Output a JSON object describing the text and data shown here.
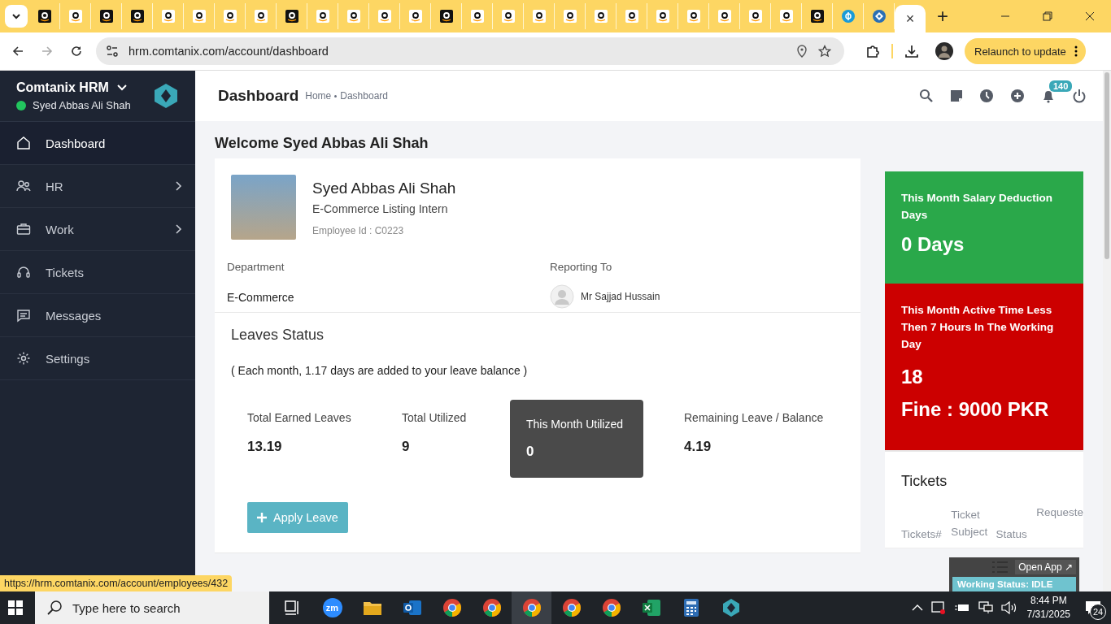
{
  "browser": {
    "tabs": [
      {
        "kind": "amazon_dark",
        "selected": false
      },
      {
        "kind": "amazon_light",
        "selected": false
      },
      {
        "kind": "amazon_dark",
        "selected": false
      },
      {
        "kind": "amazon_dark",
        "selected": false
      },
      {
        "kind": "amazon_light",
        "selected": false
      },
      {
        "kind": "amazon_light",
        "selected": false
      },
      {
        "kind": "amazon_light",
        "selected": false
      },
      {
        "kind": "amazon_light",
        "selected": false
      },
      {
        "kind": "amazon_dark",
        "selected": false
      },
      {
        "kind": "amazon_light",
        "selected": false
      },
      {
        "kind": "amazon_light",
        "selected": false
      },
      {
        "kind": "amazon_light",
        "selected": false
      },
      {
        "kind": "amazon_light",
        "selected": false
      },
      {
        "kind": "amazon_dark",
        "selected": false
      },
      {
        "kind": "amazon_light",
        "selected": false
      },
      {
        "kind": "amazon_light",
        "selected": false
      },
      {
        "kind": "amazon_light",
        "selected": false
      },
      {
        "kind": "amazon_light",
        "selected": false
      },
      {
        "kind": "amazon_light",
        "selected": false
      },
      {
        "kind": "amazon_light",
        "selected": false
      },
      {
        "kind": "amazon_light",
        "selected": false
      },
      {
        "kind": "amazon_light",
        "selected": false
      },
      {
        "kind": "amazon_light",
        "selected": false
      },
      {
        "kind": "amazon_light",
        "selected": false
      },
      {
        "kind": "amazon_light",
        "selected": false
      },
      {
        "kind": "amazon_dark",
        "selected": false
      },
      {
        "kind": "payment",
        "selected": false
      },
      {
        "kind": "hrm",
        "selected": false
      },
      {
        "kind": "blank",
        "selected": true,
        "close": "×"
      }
    ],
    "new_tab": "+",
    "address": "hrm.comtanix.com/account/dashboard",
    "relaunch": "Relaunch to update"
  },
  "sidebar": {
    "brand": "Comtanix HRM",
    "user": "Syed Abbas Ali Shah",
    "online": true,
    "items": [
      {
        "label": "Dashboard",
        "kind": "home",
        "selected": true,
        "has_children": false
      },
      {
        "label": "HR",
        "kind": "users",
        "selected": false,
        "has_children": true
      },
      {
        "label": "Work",
        "kind": "briefcase",
        "selected": false,
        "has_children": true
      },
      {
        "label": "Tickets",
        "kind": "headset",
        "selected": false,
        "has_children": false
      },
      {
        "label": "Messages",
        "kind": "message",
        "selected": false,
        "has_children": false
      },
      {
        "label": "Settings",
        "kind": "gear",
        "selected": false,
        "has_children": false
      }
    ]
  },
  "header": {
    "title": "Dashboard",
    "breadcrumb": [
      "Home",
      "Dashboard"
    ],
    "notifications": "140"
  },
  "welcome": "Welcome Syed Abbas Ali Shah",
  "profile": {
    "name": "Syed Abbas Ali Shah",
    "role": "E-Commerce Listing Intern",
    "employee_id": "Employee Id : C0223",
    "department_label": "Department",
    "department": "E-Commerce",
    "reporting_label": "Reporting To",
    "reporting_to": "Mr Sajjad Hussain"
  },
  "leaves": {
    "title": "Leaves Status",
    "note": "( Each month, 1.17 days are added to your leave balance )",
    "stats": [
      {
        "label": "Total Earned Leaves",
        "value": "13.19",
        "highlighted": false
      },
      {
        "label": "Total Utilized",
        "value": "9",
        "highlighted": false
      },
      {
        "label": "This Month Utilized",
        "value": "0",
        "highlighted": true
      },
      {
        "label": "Remaining Leave / Balance",
        "value": "4.19",
        "highlighted": false
      }
    ],
    "apply": "Apply Leave"
  },
  "deduction_card": {
    "title": "This Month Salary Deduction Days",
    "value": "0 Days"
  },
  "active_time_card": {
    "title": "This Month Active Time Less Then 7 Hours In The Working Day",
    "count": "18",
    "fine": "Fine : 9000 PKR"
  },
  "tickets": {
    "title": "Tickets",
    "columns": [
      "Tickets#",
      "Ticket Subject",
      "Status",
      "Requeste"
    ]
  },
  "widget": {
    "open_app": "Open App ↗",
    "status": "Working Status: IDLE"
  },
  "status_url": "https://hrm.comtanix.com/account/employees/432",
  "taskbar": {
    "search_placeholder": "Type here to search",
    "apps": [
      {
        "kind": "task_view",
        "selected": false
      },
      {
        "kind": "zoom",
        "label": "zm",
        "selected": false
      },
      {
        "kind": "explorer",
        "selected": false
      },
      {
        "kind": "outlook",
        "selected": false
      },
      {
        "kind": "chrome",
        "selected": false
      },
      {
        "kind": "chrome",
        "selected": false
      },
      {
        "kind": "chrome",
        "selected": true
      },
      {
        "kind": "chrome",
        "selected": false
      },
      {
        "kind": "chrome",
        "selected": false
      },
      {
        "kind": "excel",
        "selected": false
      },
      {
        "kind": "calculator",
        "selected": false
      },
      {
        "kind": "hrm",
        "selected": false
      }
    ],
    "time": "8:44 PM",
    "date": "7/31/2025",
    "notifications": "24"
  }
}
